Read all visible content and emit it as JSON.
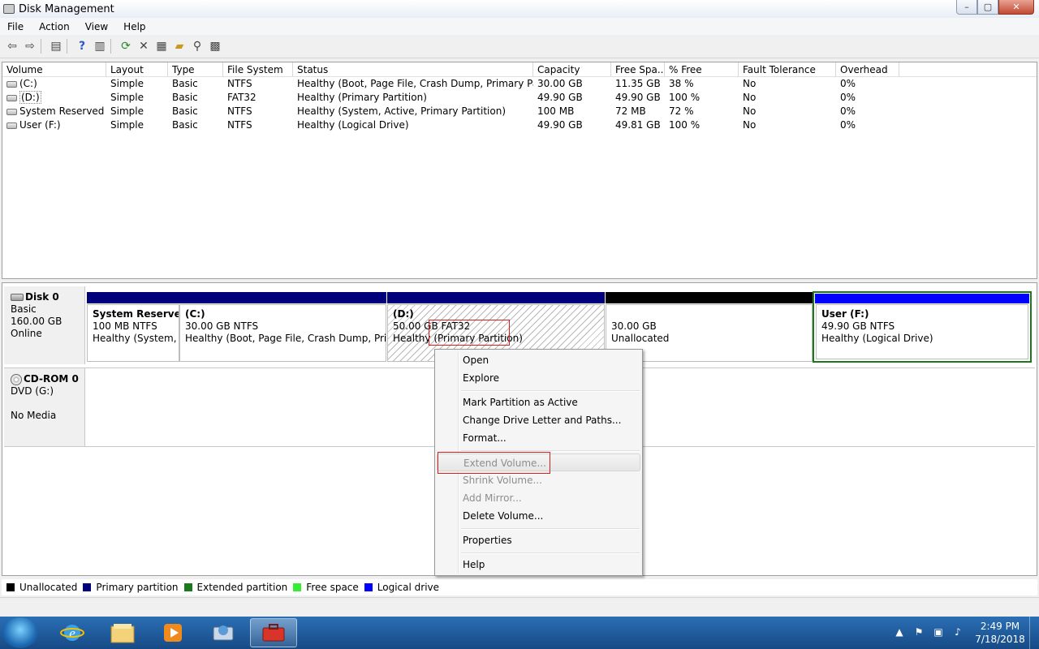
{
  "window": {
    "title": "Disk Management",
    "controls": {
      "minimize": "–",
      "maximize": "▢",
      "close": "✕"
    }
  },
  "menu": [
    "File",
    "Action",
    "View",
    "Help"
  ],
  "toolbar": [
    "back-arrow-icon",
    "forward-arrow-icon",
    "console-tree-icon",
    "help-icon",
    "show-hide-icon",
    "refresh-icon",
    "delete-icon",
    "properties-icon",
    "open-folder-icon",
    "search-icon",
    "settings-icon"
  ],
  "volume_table": {
    "headers": [
      "Volume",
      "Layout",
      "Type",
      "File System",
      "Status",
      "Capacity",
      "Free Spa...",
      "% Free",
      "Fault Tolerance",
      "Overhead"
    ],
    "rows": [
      [
        "(C:)",
        "Simple",
        "Basic",
        "NTFS",
        "Healthy (Boot, Page File, Crash Dump, Primary Partit...",
        "30.00 GB",
        "11.35 GB",
        "38 %",
        "No",
        "0%"
      ],
      [
        "(D:)",
        "Simple",
        "Basic",
        "FAT32",
        "Healthy (Primary Partition)",
        "49.90 GB",
        "49.90 GB",
        "100 %",
        "No",
        "0%"
      ],
      [
        "System Reserved",
        "Simple",
        "Basic",
        "NTFS",
        "Healthy (System, Active, Primary Partition)",
        "100 MB",
        "72 MB",
        "72 %",
        "No",
        "0%"
      ],
      [
        "User (F:)",
        "Simple",
        "Basic",
        "NTFS",
        "Healthy (Logical Drive)",
        "49.90 GB",
        "49.81 GB",
        "100 %",
        "No",
        "0%"
      ]
    ]
  },
  "disk0": {
    "name": "Disk 0",
    "type": "Basic",
    "size": "160.00 GB",
    "state": "Online",
    "partitions": [
      {
        "name": "System Reserved",
        "size_fs": "100 MB NTFS",
        "status": "Healthy (System, A",
        "bar_color": "#00007a"
      },
      {
        "name": "(C:)",
        "size_fs": "30.00 GB NTFS",
        "status": "Healthy (Boot, Page File, Crash Dump, Primar",
        "bar_color": "#00007a"
      },
      {
        "name": "(D:)",
        "size": "50.00 GB",
        "fs": "FAT32",
        "status_pre": "Healthy",
        "status_box": "(Primary Partition)",
        "bar_color": "#00007a"
      },
      {
        "name": "",
        "size_fs": "30.00 GB",
        "status": "Unallocated",
        "bar_color": "#000000"
      },
      {
        "name": "User  (F:)",
        "size_fs": "49.90 GB NTFS",
        "status": "Healthy (Logical Drive)",
        "bar_color": "#0000ff"
      }
    ]
  },
  "cdrom0": {
    "name": "CD-ROM 0",
    "drive": "DVD (G:)",
    "state": "No Media"
  },
  "context_menu": {
    "items": [
      {
        "label": "Open",
        "disabled": false
      },
      {
        "label": "Explore",
        "disabled": false
      },
      {
        "label": "Mark Partition as Active",
        "disabled": false
      },
      {
        "label": "Change Drive Letter and Paths...",
        "disabled": false
      },
      {
        "label": "Format...",
        "disabled": false
      },
      {
        "label": "Extend Volume...",
        "disabled": true
      },
      {
        "label": "Shrink Volume...",
        "disabled": true
      },
      {
        "label": "Add Mirror...",
        "disabled": true
      },
      {
        "label": "Delete Volume...",
        "disabled": false
      },
      {
        "label": "Properties",
        "disabled": false
      },
      {
        "label": "Help",
        "disabled": false
      }
    ]
  },
  "legend": [
    {
      "label": "Unallocated",
      "color": "#000000"
    },
    {
      "label": "Primary partition",
      "color": "#00007a"
    },
    {
      "label": "Extended partition",
      "color": "#1a7a1a"
    },
    {
      "label": "Free space",
      "color": "#33ee33"
    },
    {
      "label": "Logical drive",
      "color": "#0000ff"
    }
  ],
  "taskbar": {
    "apps": [
      "internet-explorer-icon",
      "file-explorer-icon",
      "media-player-icon",
      "control-panel-icon",
      "disk-management-icon"
    ],
    "clock_time": "2:49 PM",
    "clock_date": "7/18/2018"
  }
}
